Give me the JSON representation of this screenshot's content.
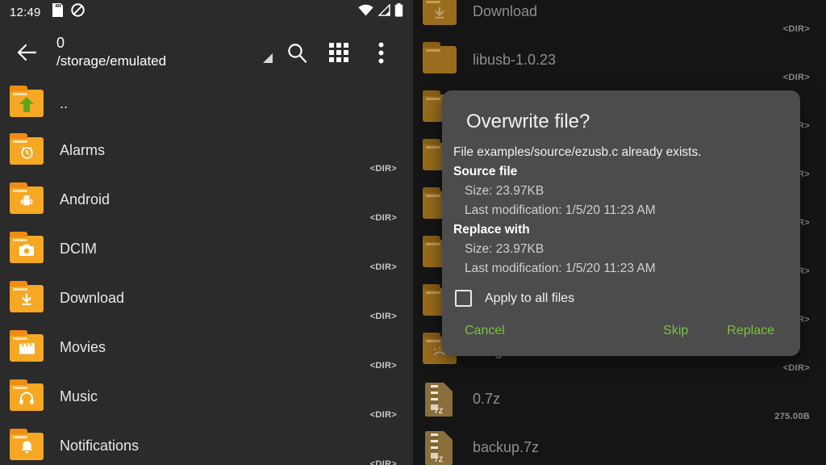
{
  "status_bar": {
    "clock": "12:49",
    "left_icons": [
      "sd-card-icon",
      "do-not-disturb-icon"
    ],
    "right_icons": [
      "wifi-icon",
      "cell-signal-icon",
      "battery-icon"
    ]
  },
  "toolbar": {
    "back_icon": "back-arrow-icon",
    "title": "0",
    "path": "/storage/emulated",
    "spinner_icon": "dropdown-triangle-icon",
    "search_icon": "search-icon",
    "grid_icon": "grid-view-icon",
    "overflow_icon": "overflow-menu-icon"
  },
  "left_list": {
    "items": [
      {
        "name": "..",
        "meta": "",
        "icon": "folder-up-icon",
        "glyph": "↑",
        "type": "folder-up"
      },
      {
        "name": "Alarms",
        "meta": "<DIR>",
        "icon": "folder-alarms-icon",
        "glyph": "⏰",
        "type": "folder"
      },
      {
        "name": "Android",
        "meta": "<DIR>",
        "icon": "folder-android-icon",
        "glyph": "▣",
        "type": "folder"
      },
      {
        "name": "DCIM",
        "meta": "<DIR>",
        "icon": "folder-dcim-icon",
        "glyph": "■",
        "type": "folder"
      },
      {
        "name": "Download",
        "meta": "<DIR>",
        "icon": "folder-download-icon",
        "glyph": "⬇",
        "type": "folder"
      },
      {
        "name": "Movies",
        "meta": "<DIR>",
        "icon": "folder-movies-icon",
        "glyph": "▰",
        "type": "folder"
      },
      {
        "name": "Music",
        "meta": "<DIR>",
        "icon": "folder-music-icon",
        "glyph": "♫",
        "type": "folder"
      },
      {
        "name": "Notifications",
        "meta": "<DIR>",
        "icon": "folder-notifications-icon",
        "glyph": "ὑ4",
        "type": "folder"
      }
    ]
  },
  "right_list": {
    "items": [
      {
        "name": "Download",
        "meta": "<DIR>",
        "icon": "folder-download-icon",
        "glyph": "⬇",
        "type": "folder"
      },
      {
        "name": "libusb-1.0.23",
        "meta": "<DIR>",
        "icon": "folder-icon",
        "glyph": "",
        "type": "folder"
      },
      {
        "name": "",
        "meta": "<DIR>",
        "icon": "folder-icon",
        "glyph": "",
        "type": "folder"
      },
      {
        "name": "",
        "meta": "<DIR>",
        "icon": "folder-icon",
        "glyph": "",
        "type": "folder"
      },
      {
        "name": "",
        "meta": "<DIR>",
        "icon": "folder-icon",
        "glyph": "",
        "type": "folder"
      },
      {
        "name": "",
        "meta": "<DIR>",
        "icon": "folder-icon",
        "glyph": "",
        "type": "folder"
      },
      {
        "name": "",
        "meta": "<DIR>",
        "icon": "folder-icon",
        "glyph": "",
        "type": "folder"
      },
      {
        "name": "Ringtones",
        "meta": "<DIR>",
        "icon": "folder-ringtones-icon",
        "glyph": "☎",
        "type": "folder"
      },
      {
        "name": "0.7z",
        "meta": "275.00B",
        "icon": "archive-7z-icon",
        "glyph": "7Z",
        "type": "archive"
      },
      {
        "name": "backup.7z",
        "meta": "",
        "icon": "archive-7z-icon",
        "glyph": "7Z",
        "type": "archive"
      }
    ]
  },
  "dialog": {
    "title": "Overwrite file?",
    "message": "File examples/source/ezusb.c already exists.",
    "source_heading": "Source file",
    "source_size": "Size: 23.97KB",
    "source_modified": "Last modification: 1/5/20 11:23 AM",
    "replace_heading": "Replace with",
    "replace_size": "Size: 23.97KB",
    "replace_modified": "Last modification: 1/5/20 11:23 AM",
    "apply_all_label": "Apply to all files",
    "apply_all_checked": false,
    "cancel_label": "Cancel",
    "skip_label": "Skip",
    "replace_label": "Replace"
  },
  "colors": {
    "panel_bg": "#2b2b2b",
    "dim_panel_bg": "#151515",
    "folder": "#f6a723",
    "folder_dim": "#9a6c1d",
    "dialog_bg": "#4c4c4c",
    "accent_green": "#7bc043",
    "text_primary": "#e8e8e8",
    "text_dim": "#8e8e8e"
  }
}
